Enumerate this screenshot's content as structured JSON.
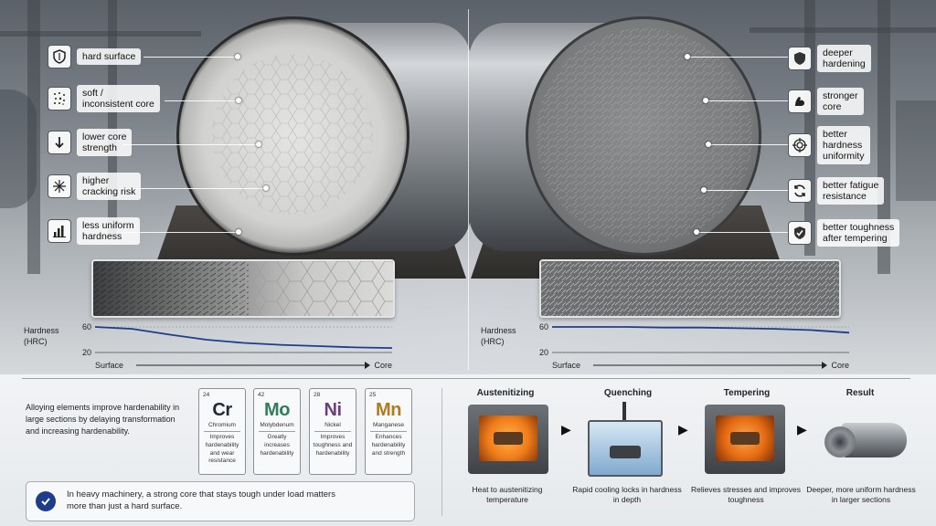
{
  "left_callouts": [
    {
      "icon": "shield-icon",
      "text": "hard surface"
    },
    {
      "icon": "dots-icon",
      "text": "soft /\ninconsistent core"
    },
    {
      "icon": "arrow-down-icon",
      "text": "lower core\nstrength"
    },
    {
      "icon": "burst-icon",
      "text": "higher\ncracking risk"
    },
    {
      "icon": "bar-chart-icon",
      "text": "less uniform\nhardness"
    }
  ],
  "right_callouts": [
    {
      "icon": "shield-icon",
      "text": "deeper\nhardening"
    },
    {
      "icon": "muscle-icon",
      "text": "stronger\ncore"
    },
    {
      "icon": "target-icon",
      "text": "better\nhardness\nuniformity"
    },
    {
      "icon": "cycle-icon",
      "text": "better fatigue\nresistance"
    },
    {
      "icon": "shield-check-icon",
      "text": "better toughness\nafter tempering"
    }
  ],
  "chart_data": [
    {
      "type": "line",
      "ylabel": "Hardness\n(HRC)",
      "yticks": [
        60,
        20
      ],
      "x_start_label": "Surface",
      "x_end_label": "Core",
      "series": [
        {
          "values": [
            60,
            57,
            48,
            40,
            35,
            32,
            30,
            28,
            27
          ]
        }
      ]
    },
    {
      "type": "line",
      "ylabel": "Hardness\n(HRC)",
      "yticks": [
        60,
        20
      ],
      "x_start_label": "Surface",
      "x_end_label": "Core",
      "series": [
        {
          "values": [
            60,
            60,
            60,
            59,
            59,
            58,
            57,
            55,
            51
          ]
        }
      ]
    }
  ],
  "alloy_text": "Alloying elements improve hardenability in large sections by delaying transformation and increasing hardenability.",
  "elements": [
    {
      "num": "24",
      "sym": "Cr",
      "name": "Chromium",
      "desc": "Improves hardenability and wear resistance",
      "color": "#1f2a36"
    },
    {
      "num": "42",
      "sym": "Mo",
      "name": "Molybdenum",
      "desc": "Greatly increases hardenability",
      "color": "#2f7d5b"
    },
    {
      "num": "28",
      "sym": "Ni",
      "name": "Nickel",
      "desc": "Improves toughness and hardenability",
      "color": "#6b3f7d"
    },
    {
      "num": "25",
      "sym": "Mn",
      "name": "Manganese",
      "desc": "Enhances hardenability and strength",
      "color": "#b07a1e"
    }
  ],
  "note_text": "In heavy machinery, a strong core that stays tough under load matters more than just a hard surface.",
  "steps": [
    {
      "title": "Austenitizing",
      "caption": "Heat to austenitizing temperature"
    },
    {
      "title": "Quenching",
      "caption": "Rapid cooling locks in hardness in depth"
    },
    {
      "title": "Tempering",
      "caption": "Relieves stresses and improves toughness"
    },
    {
      "title": "Result",
      "caption": "Deeper, more uniform hardness in larger sections"
    }
  ],
  "colors": {
    "curve": "#1d3f8a",
    "accent": "#1d3c8a",
    "glow": "#f08a1e"
  }
}
